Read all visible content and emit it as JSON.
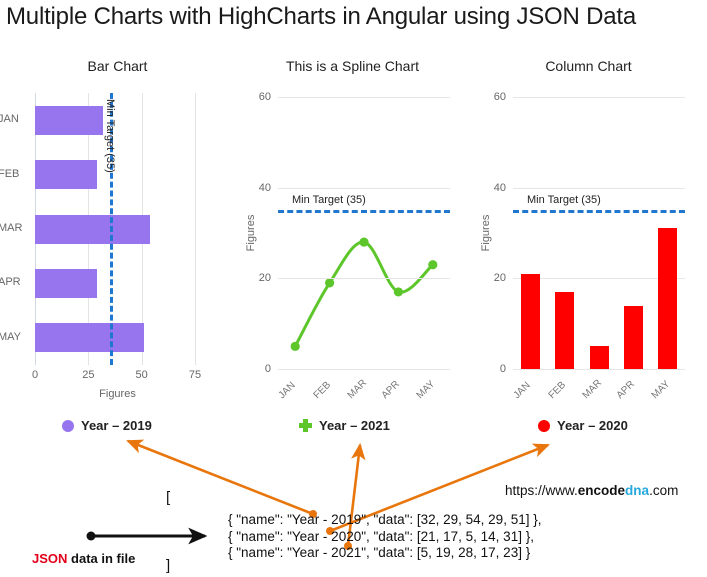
{
  "page": {
    "title": "Multiple Charts with HighCharts in Angular using JSON Data",
    "site_url_prefix": "https://www.",
    "site_url_bold": "encode",
    "site_url_accent": "dna",
    "site_url_suffix": ".com"
  },
  "colors": {
    "purple_2019": "#9775ef",
    "green_2021": "#5cc62a",
    "red_2020": "#ff0000",
    "min_target_blue": "#1f77d0",
    "arrow_orange": "#e8760c",
    "json_keyword_red": "#e2001a",
    "url_accent_blue": "#26a9e0",
    "gridline": "#e6e6e6"
  },
  "legends": [
    {
      "name": "legend-2019",
      "label": "Year – 2019",
      "marker": "circle-marker",
      "color": "#9775ef"
    },
    {
      "name": "legend-2021",
      "label": "Year – 2021",
      "marker": "plus-marker",
      "color": "#5cc62a"
    },
    {
      "name": "legend-2020",
      "label": "Year – 2020",
      "marker": "circle-marker",
      "color": "#ff0000"
    }
  ],
  "code_block": {
    "bracket_open": "[",
    "bracket_close": "]",
    "lines": "{ \"name\": \"Year - 2019\", \"data\": [32, 29, 54, 29, 51] },\n{ \"name\": \"Year - 2020\", \"data\": [21, 17, 5, 14, 31] },\n{ \"name\": \"Year - 2021\", \"data\": [5, 19, 28, 17, 23] }",
    "caption_keyword": "JSON",
    "caption_rest": " data in file"
  },
  "chart_data": [
    {
      "name": "bar-chart",
      "type": "bar",
      "title": "Bar Chart",
      "series_name": "Year – 2019",
      "categories": [
        "JAN",
        "FEB",
        "MAR",
        "APR",
        "MAY"
      ],
      "values": [
        32,
        29,
        54,
        29,
        51
      ],
      "color": "#9775ef",
      "xlabel": "Figures",
      "ylabel": "",
      "value_axis_ticks": [
        0,
        25,
        50,
        75
      ],
      "value_axis_range": [
        0,
        75
      ],
      "plotline": {
        "label": "Min Target (35)",
        "value": 35,
        "color": "#1f77d0",
        "orientation": "vertical"
      },
      "grid": true,
      "legend_position": "below"
    },
    {
      "name": "spline-chart",
      "type": "line",
      "title": "This is a Spline Chart",
      "series_name": "Year – 2021",
      "categories": [
        "JAN",
        "FEB",
        "MAR",
        "APR",
        "MAY"
      ],
      "values": [
        5,
        19,
        28,
        17,
        23
      ],
      "color": "#5cc62a",
      "xlabel": "",
      "ylabel": "Figures",
      "value_axis_ticks": [
        0,
        20,
        40,
        60
      ],
      "value_axis_range": [
        0,
        60
      ],
      "plotline": {
        "label": "Min Target (35)",
        "value": 35,
        "color": "#1f77d0",
        "orientation": "horizontal"
      },
      "grid": true,
      "legend_position": "below"
    },
    {
      "name": "column-chart",
      "type": "bar",
      "title": "Column Chart",
      "series_name": "Year – 2020",
      "categories": [
        "JAN",
        "FEB",
        "MAR",
        "APR",
        "MAY"
      ],
      "values": [
        21,
        17,
        5,
        14,
        31
      ],
      "color": "#ff0000",
      "xlabel": "",
      "ylabel": "Figures",
      "value_axis_ticks": [
        0,
        20,
        40,
        60
      ],
      "value_axis_range": [
        0,
        60
      ],
      "plotline": {
        "label": "Min Target (35)",
        "value": 35,
        "color": "#1f77d0",
        "orientation": "horizontal"
      },
      "grid": true,
      "legend_position": "below"
    }
  ]
}
